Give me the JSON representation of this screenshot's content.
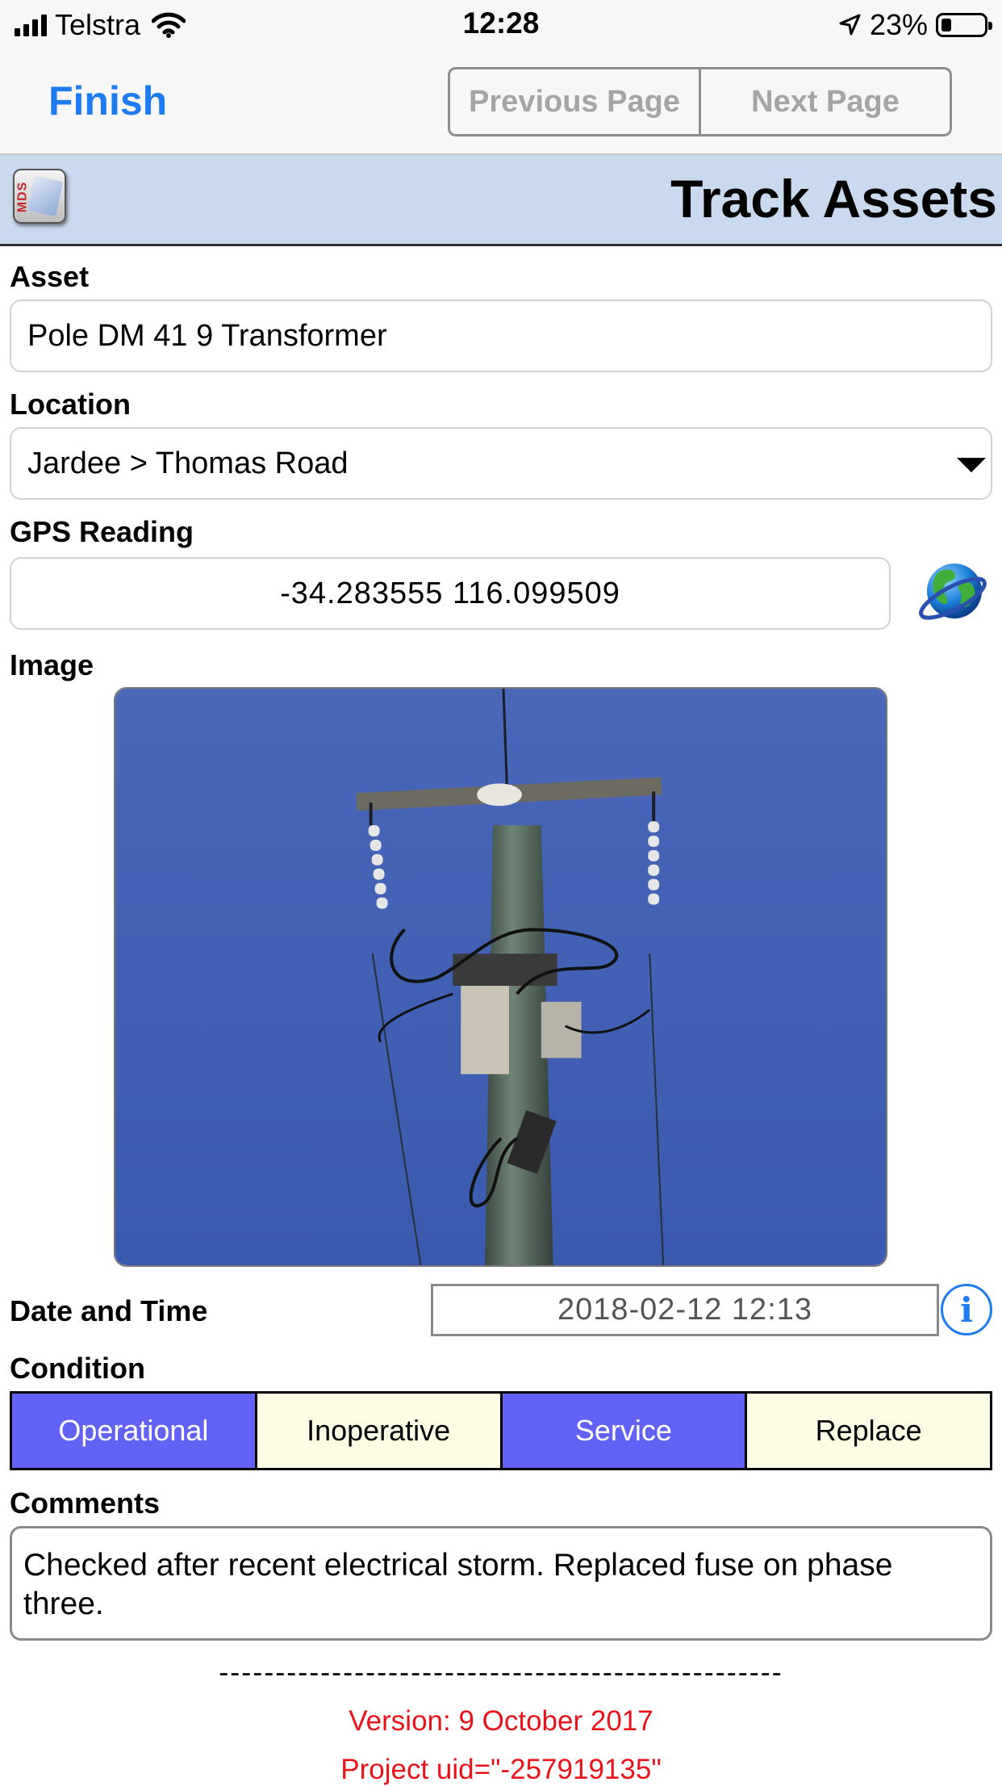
{
  "status_bar": {
    "carrier": "Telstra",
    "time": "12:28",
    "battery_percent": "23%",
    "battery_level": 0.23,
    "icons": [
      "signal-icon",
      "wifi-icon",
      "location-arrow-icon",
      "battery-icon"
    ]
  },
  "nav": {
    "finish_label": "Finish",
    "previous_label": "Previous Page",
    "next_label": "Next Page",
    "accent_color": "#1e7cf0"
  },
  "header": {
    "logo_text": "MDS",
    "title": "Track Assets",
    "background_color": "#c9d9ee"
  },
  "form": {
    "asset_label": "Asset",
    "asset_value": "Pole DM 41 9 Transformer",
    "location_label": "Location",
    "location_value": "Jardee > Thomas Road",
    "gps_label": "GPS Reading",
    "gps_value": "-34.283555 116.099509",
    "image_label": "Image",
    "datetime_label": "Date and Time",
    "datetime_value": "2018-02-12 12:13",
    "condition_label": "Condition",
    "conditions": [
      {
        "label": "Operational",
        "selected": true
      },
      {
        "label": "Inoperative",
        "selected": false
      },
      {
        "label": "Service",
        "selected": true
      },
      {
        "label": "Replace",
        "selected": false
      }
    ],
    "condition_selected_color": "#6262f7",
    "condition_unselected_color": "#fdfde6",
    "comments_label": "Comments",
    "comments_value": "Checked after recent electrical storm. Replaced fuse on phase three."
  },
  "footer": {
    "divider": "--------------------------------------------------",
    "version": "Version: 9 October 2017",
    "project": "Project uid=\"-257919135\"",
    "text_color": "#e8141a"
  }
}
